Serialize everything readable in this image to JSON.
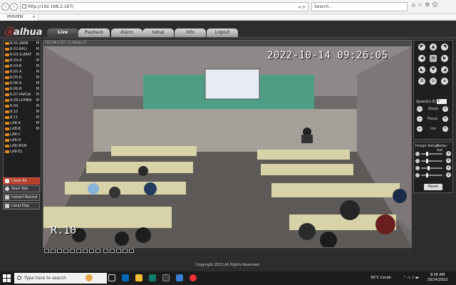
{
  "browser": {
    "url": "http://192.168.2.167/",
    "search_placeholder": "Search...",
    "tab_title": "PREVIEW",
    "tab_close": "×"
  },
  "app": {
    "logo_text": "alhua",
    "nav": [
      {
        "label": "Live",
        "active": true
      },
      {
        "label": "Playback"
      },
      {
        "label": "Alarm"
      },
      {
        "label": "Setup"
      },
      {
        "label": "Info"
      },
      {
        "label": "Logout"
      }
    ],
    "channels": [
      {
        "label": "R.01-JAWA",
        "flag": "M"
      },
      {
        "label": "R.02-BALI",
        "flag": "M"
      },
      {
        "label": "R.03-SUMAT",
        "flag": "M"
      },
      {
        "label": "R.04-A",
        "flag": "M"
      },
      {
        "label": "R.04-B",
        "flag": "M"
      },
      {
        "label": "R.05-A",
        "flag": "M"
      },
      {
        "label": "R.05-B",
        "flag": "M"
      },
      {
        "label": "R.06-A",
        "flag": "M"
      },
      {
        "label": "R.06-B",
        "flag": "M"
      },
      {
        "label": "R.07-PAPUA",
        "flag": "M"
      },
      {
        "label": "R.08-LOMBK",
        "flag": "M"
      },
      {
        "label": "R.09",
        "flag": "M"
      },
      {
        "label": "R.10",
        "flag": "M"
      },
      {
        "label": "R.11",
        "flag": "M"
      },
      {
        "label": "LAB-A",
        "flag": "M"
      },
      {
        "label": "LAB-B",
        "flag": "M"
      },
      {
        "label": "LAB-C",
        "flag": ""
      },
      {
        "label": "LAB-D",
        "flag": ""
      },
      {
        "label": "LAB-IRSN",
        "flag": ""
      },
      {
        "label": "LAB-EL",
        "flag": ""
      }
    ],
    "controls": {
      "close_all": "Close All",
      "start_talk": "Start Talk",
      "instant_record": "Instant Record",
      "local_play": "Local Play"
    },
    "video": {
      "info": "192.168.2.167_12_98kbps_M",
      "osd_time": "2022-10-14 09:26:05",
      "osd_name": "R.10"
    },
    "ptz": {
      "speed_label": "Speed(1-8)",
      "speed_value": "5",
      "zoom_label": "Zoom",
      "focus_label": "Focus",
      "iris_label": "Iris",
      "minus": "−",
      "plus": "+"
    },
    "image_setup": {
      "tab1": "Image Setup",
      "tab2": "Relay-out",
      "reset_label": "Reset",
      "levels": [
        0.25,
        0.25,
        0.35,
        0.25
      ]
    },
    "copyright": "Copyright 2015,All Rights Reserved."
  },
  "taskbar": {
    "search_placeholder": "Type here to search",
    "weather": "30°C  Cerah",
    "time": "9:26 AM",
    "date": "10/14/2022"
  }
}
